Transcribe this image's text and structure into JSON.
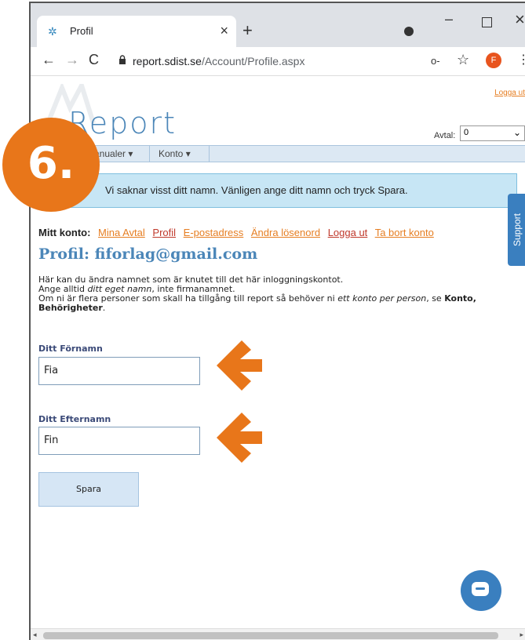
{
  "browser": {
    "tab_title": "Profil",
    "tab_close": "×",
    "new_tab": "+",
    "url_host": "report.sdist.se",
    "url_path": "/Account/Profile.aspx",
    "avatar_letter": "F",
    "win_min": "–",
    "win_close": "×",
    "nav_back": "←",
    "nav_fwd": "→",
    "nav_reload": "C",
    "key_icon": "o‑",
    "star_icon": "☆",
    "menu_icon": "⋮"
  },
  "header": {
    "logo": "Report",
    "logout": "Logga ut",
    "avtal_label": "Avtal:",
    "avtal_value": "0"
  },
  "menu": {
    "items": [
      {
        "label": "Manualer ▾"
      },
      {
        "label": "Konto ▾"
      }
    ]
  },
  "alert": {
    "text": "Vi saknar visst ditt namn. Vänligen ange ditt namn och tryck Spara."
  },
  "account": {
    "label": "Mitt konto:",
    "links": [
      {
        "label": "Mina Avtal"
      },
      {
        "label": "Profil"
      },
      {
        "label": "E-postadress"
      },
      {
        "label": "Ändra lösenord"
      },
      {
        "label": "Logga ut"
      },
      {
        "label": "Ta bort konto"
      }
    ]
  },
  "page": {
    "title": "Profil: fiforlag@gmail.com",
    "desc_line1": "Här kan du ändra namnet som är knutet till det här inloggningskontot.",
    "desc_line2_a": "Ange alltid ",
    "desc_line2_em": "ditt eget namn",
    "desc_line2_b": ", inte firmanamnet.",
    "desc_line3_a": "Om ni är flera personer som skall ha tillgång till report så behöver ni ",
    "desc_line3_em": "ett konto per person",
    "desc_line3_b": ", se ",
    "desc_line3_strong": "Konto, Behörigheter",
    "desc_line3_end": "."
  },
  "form": {
    "first_name_label": "Ditt Förnamn",
    "first_name_value": "Fia",
    "last_name_label": "Ditt Efternamn",
    "last_name_value": "Fin",
    "save_label": "Spara"
  },
  "support": {
    "label": "Support"
  },
  "overlay": {
    "step": "6.",
    "accent": "#e8761a"
  }
}
